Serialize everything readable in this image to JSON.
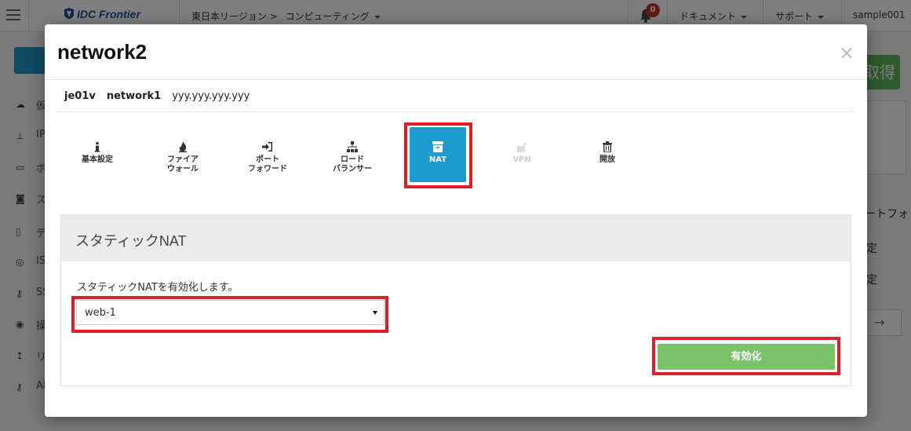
{
  "background": {
    "logo_text": "IDC Frontier",
    "region_breadcrumb": "東日本リージョン >",
    "region_menu": "コンピューティング",
    "notification_count": "0",
    "menu_documents": "ドキュメント",
    "menu_support": "サポート",
    "menu_user": "sample001",
    "sidebar_items": [
      {
        "icon": "cloud-icon",
        "label": "仮"
      },
      {
        "icon": "network-icon",
        "label": "IP"
      },
      {
        "icon": "storage-icon",
        "label": "ボ"
      },
      {
        "icon": "camera-icon",
        "label": "ス"
      },
      {
        "icon": "document-icon",
        "label": "デ"
      },
      {
        "icon": "disc-icon",
        "label": "IS"
      },
      {
        "icon": "key-icon",
        "label": "SS"
      },
      {
        "icon": "eye-icon",
        "label": "操"
      },
      {
        "icon": "upload-icon",
        "label": "リ"
      },
      {
        "icon": "key-icon",
        "label": "AP"
      }
    ],
    "right_button_label": "取得",
    "right_text_1": "ートフォ",
    "right_text_2": "定",
    "right_text_3": "定",
    "right_arrow": "→"
  },
  "modal": {
    "title": "network2",
    "close_label": "×",
    "breadcrumb": {
      "zone": "je01v",
      "network": "network1",
      "ip": "yyy.yyy.yyy.yyy"
    },
    "tabs": [
      {
        "icon": "info-icon",
        "label_line1": "基本設定",
        "label_line2": ""
      },
      {
        "icon": "fire-icon",
        "label_line1": "ファイア",
        "label_line2": "ウォール"
      },
      {
        "icon": "sign-in-icon",
        "label_line1": "ポート",
        "label_line2": "フォワード"
      },
      {
        "icon": "sitemap-icon",
        "label_line1": "ロード",
        "label_line2": "バランサー"
      },
      {
        "icon": "archive-icon",
        "label_line1": "NAT",
        "label_line2": ""
      },
      {
        "icon": "unlock-icon",
        "label_line1": "VPN",
        "label_line2": ""
      },
      {
        "icon": "trash-icon",
        "label_line1": "開放",
        "label_line2": ""
      }
    ],
    "active_tab": "NAT",
    "section_title": "スタティックNAT",
    "description": "スタティックNATを有効化します。",
    "select_value": "web-1",
    "enable_button": "有効化",
    "accent_color": "#1e9bd0",
    "enable_color": "#7cc26b",
    "highlight_color": "#e01e25"
  }
}
